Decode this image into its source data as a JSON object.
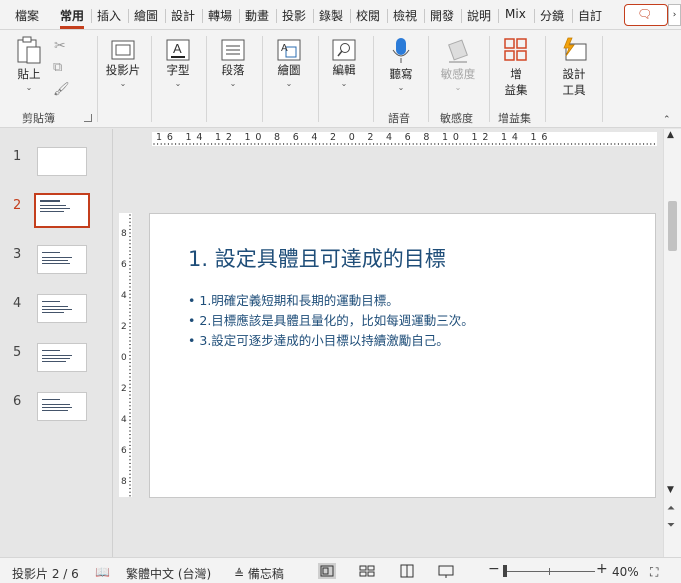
{
  "tabs": [
    {
      "label": "檔案",
      "active": false
    },
    {
      "label": "常用",
      "active": true
    },
    {
      "label": "插入",
      "active": false
    },
    {
      "label": "繪圖",
      "active": false
    },
    {
      "label": "設計",
      "active": false
    },
    {
      "label": "轉場",
      "active": false
    },
    {
      "label": "動畫",
      "active": false
    },
    {
      "label": "投影",
      "active": false
    },
    {
      "label": "錄製",
      "active": false
    },
    {
      "label": "校閱",
      "active": false
    },
    {
      "label": "檢視",
      "active": false
    },
    {
      "label": "開發",
      "active": false
    },
    {
      "label": "說明",
      "active": false
    },
    {
      "label": "Mix",
      "active": false
    },
    {
      "label": "分鏡",
      "active": false
    },
    {
      "label": "自訂",
      "active": false
    }
  ],
  "ribbon": {
    "paste": "貼上",
    "slides": "投影片",
    "font": "字型",
    "paragraph": "段落",
    "drawing": "繪圖",
    "editing": "編輯",
    "dictate": "聽寫",
    "sensitivity": "敏感度",
    "addins_line1": "增",
    "addins_line2": "益集",
    "designer_line1": "設計",
    "designer_line2": "工具",
    "groups": {
      "clipboard": "剪貼簿",
      "voice": "語音",
      "sensitivity": "敏感度",
      "addins": "增益集"
    }
  },
  "ruler": {
    "horizontal": "16 14 12 10 8 6 4 2 0 2 4 6 8 10 12 14 16",
    "vertical": "8 6 4 2 0 2 4 6 8"
  },
  "thumbnails": [
    {
      "num": "1",
      "selected": false
    },
    {
      "num": "2",
      "selected": true
    },
    {
      "num": "3",
      "selected": false
    },
    {
      "num": "4",
      "selected": false
    },
    {
      "num": "5",
      "selected": false
    },
    {
      "num": "6",
      "selected": false
    }
  ],
  "slide": {
    "title": "1. 設定具體且可達成的目標",
    "bullets": [
      "1.明確定義短期和長期的運動目標。",
      "2.目標應該是具體且量化的，比如每週運動三次。",
      "3.設定可逐步達成的小目標以持續激勵自己。"
    ]
  },
  "status": {
    "slide_info": "投影片 2 / 6",
    "language": "繁體中文 (台灣)",
    "notes": "備忘稿",
    "zoom": "40%"
  },
  "colors": {
    "accent": "#c43e1c",
    "slide_text": "#1f4e79"
  }
}
